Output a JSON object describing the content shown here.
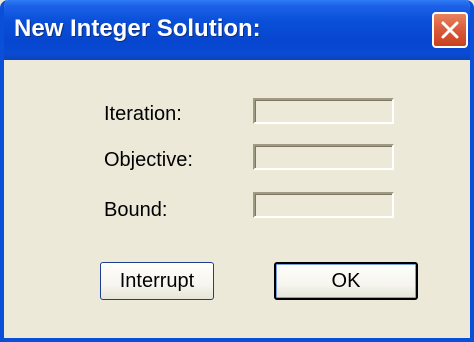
{
  "dialog": {
    "title": "New Integer Solution:",
    "close_icon": "close-icon",
    "fields": [
      {
        "label": "Iteration:",
        "value": ""
      },
      {
        "label": "Objective:",
        "value": ""
      },
      {
        "label": "Bound:",
        "value": ""
      }
    ],
    "buttons": {
      "interrupt": "Interrupt",
      "ok": "OK"
    }
  },
  "colors": {
    "titlebar": "#0a4fd8",
    "background": "#ece9d8",
    "close_button": "#d95a3a"
  }
}
